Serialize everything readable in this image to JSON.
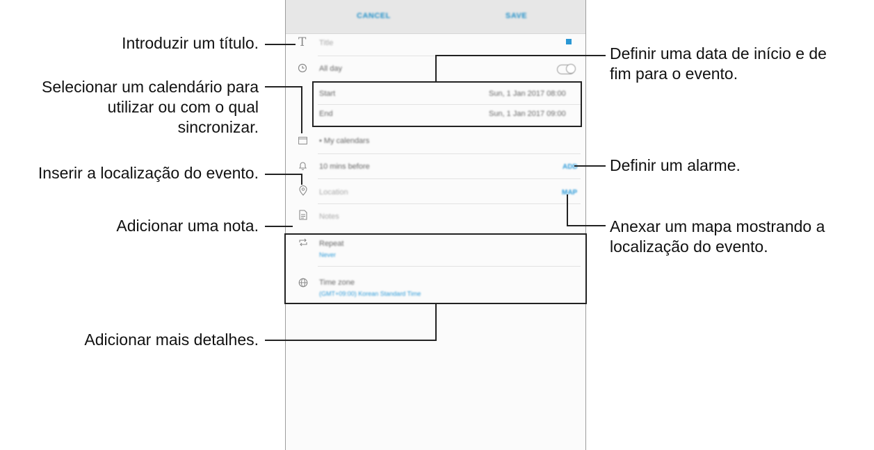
{
  "app": {
    "topbar": {
      "cancel_label": "CANCEL",
      "save_label": "SAVE"
    },
    "fields": {
      "title_placeholder": "Title",
      "all_day_label": "All day",
      "start_label": "Start",
      "start_value": "Sun, 1 Jan 2017   08:00",
      "end_label": "End",
      "end_value": "Sun, 1 Jan 2017   09:00",
      "calendar_label": "My calendars",
      "alarm_label": "10 mins before",
      "alarm_add": "ADD",
      "location_placeholder": "Location",
      "location_map": "MAP",
      "notes_placeholder": "Notes",
      "repeat_label": "Repeat",
      "repeat_value": "Never",
      "timezone_label": "Time zone",
      "timezone_value": "(GMT+09:00) Korean Standard Time"
    },
    "icons": {
      "title": "text-icon",
      "all_day": "clock-icon",
      "calendar": "calendar-icon",
      "alarm": "bell-icon",
      "location": "map-pin-icon",
      "notes": "document-icon",
      "repeat": "repeat-icon",
      "timezone": "globe-icon"
    },
    "accent_color": "#2a97d4"
  },
  "annotations": {
    "title": "Introduzir um título.",
    "calendar": [
      "Selecionar um calendário para",
      "utilizar ou com o qual",
      "sincronizar."
    ],
    "location": "Inserir a localização do evento.",
    "notes": "Adicionar uma nota.",
    "details": "Adicionar mais detalhes.",
    "dates": [
      "Definir uma data de início e de",
      "fim para o evento."
    ],
    "alarm": "Definir um alarme.",
    "map": [
      "Anexar um mapa mostrando a",
      "localização do evento."
    ]
  }
}
